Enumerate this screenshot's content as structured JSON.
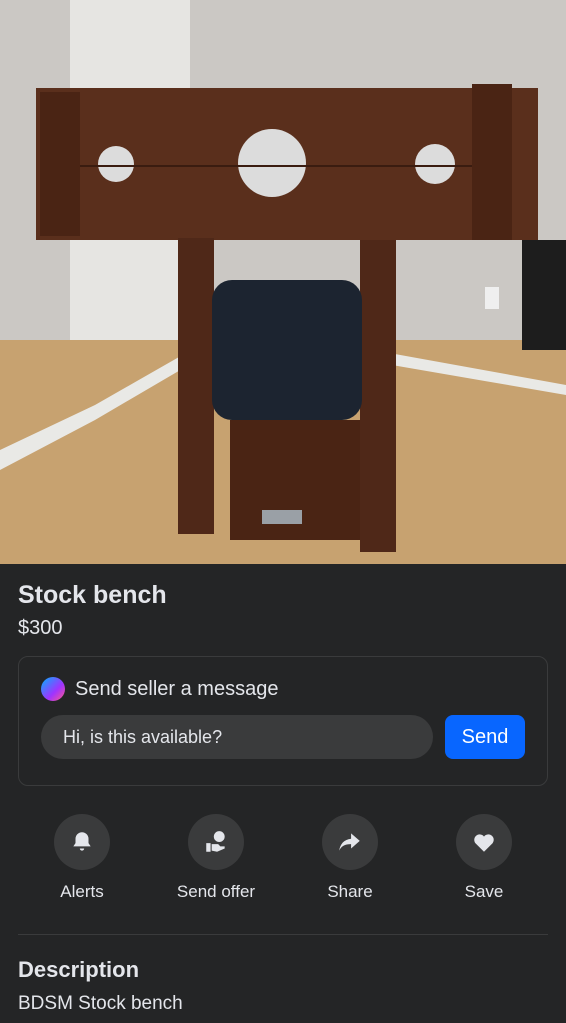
{
  "listing": {
    "title": "Stock bench",
    "price": "$300"
  },
  "message": {
    "header": "Send seller a message",
    "input_value": "Hi, is this available?",
    "send_label": "Send"
  },
  "actions": [
    {
      "label": "Alerts",
      "icon": "bell-icon"
    },
    {
      "label": "Send offer",
      "icon": "offer-icon"
    },
    {
      "label": "Share",
      "icon": "share-icon"
    },
    {
      "label": "Save",
      "icon": "heart-icon"
    }
  ],
  "description": {
    "heading": "Description",
    "text": "BDSM Stock bench"
  },
  "colors": {
    "background": "#242526",
    "accent": "#0866ff",
    "surface": "#3a3b3c"
  }
}
